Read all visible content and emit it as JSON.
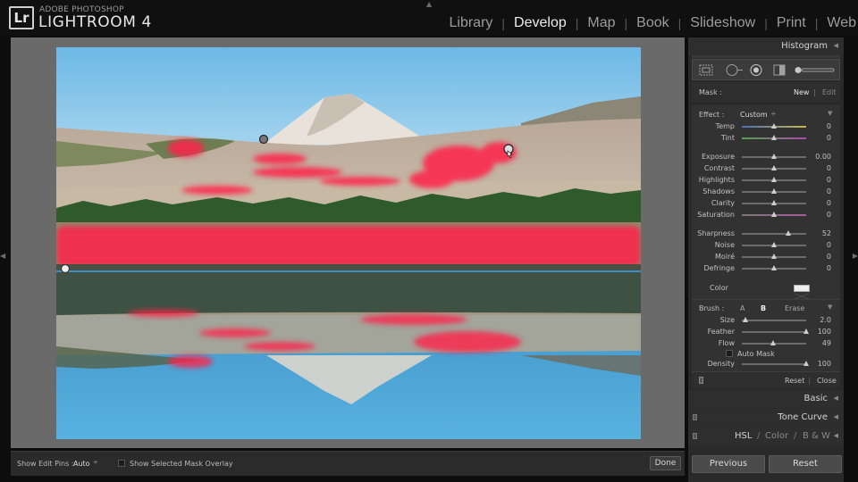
{
  "app": {
    "brand_small": "ADOBE PHOTOSHOP",
    "brand_big": "LIGHTROOM 4",
    "logo_text": "Lr"
  },
  "modules": [
    {
      "label": "Library",
      "active": false
    },
    {
      "label": "Develop",
      "active": true
    },
    {
      "label": "Map",
      "active": false
    },
    {
      "label": "Book",
      "active": false
    },
    {
      "label": "Slideshow",
      "active": false
    },
    {
      "label": "Print",
      "active": false
    },
    {
      "label": "Web",
      "active": false
    }
  ],
  "toolbar": {
    "pins_label": "Show Edit Pins :",
    "pins_value": "Auto",
    "overlay_label": "Show Selected Mask Overlay",
    "done_label": "Done"
  },
  "right_panel": {
    "histogram_title": "Histogram",
    "mask_label": "Mask :",
    "mask_new": "New",
    "mask_edit": "Edit",
    "effect_label": "Effect :",
    "effect_value": "Custom",
    "sliders_group1": [
      {
        "label": "Temp",
        "value": "0",
        "pos": 0.5
      },
      {
        "label": "Tint",
        "value": "0",
        "pos": 0.5
      }
    ],
    "sliders_group2": [
      {
        "label": "Exposure",
        "value": "0.00",
        "pos": 0.5
      },
      {
        "label": "Contrast",
        "value": "0",
        "pos": 0.5
      },
      {
        "label": "Highlights",
        "value": "0",
        "pos": 0.5
      },
      {
        "label": "Shadows",
        "value": "0",
        "pos": 0.5
      },
      {
        "label": "Clarity",
        "value": "0",
        "pos": 0.5
      },
      {
        "label": "Saturation",
        "value": "0",
        "pos": 0.5
      }
    ],
    "sliders_group3": [
      {
        "label": "Sharpness",
        "value": "52",
        "pos": 0.72
      },
      {
        "label": "Noise",
        "value": "0",
        "pos": 0.5
      },
      {
        "label": "Moiré",
        "value": "0",
        "pos": 0.5
      },
      {
        "label": "Defringe",
        "value": "0",
        "pos": 0.5
      }
    ],
    "color_label": "Color",
    "brush_label": "Brush :",
    "brush_a": "A",
    "brush_b": "B",
    "brush_erase": "Erase",
    "brush_sliders": [
      {
        "label": "Size",
        "value": "2.0",
        "pos": 0.05
      },
      {
        "label": "Feather",
        "value": "100",
        "pos": 1.0
      },
      {
        "label": "Flow",
        "value": "49",
        "pos": 0.49
      }
    ],
    "auto_mask_label": "Auto Mask",
    "density": {
      "label": "Density",
      "value": "100",
      "pos": 1.0
    },
    "reset_label": "Reset",
    "close_label": "Close",
    "sections": [
      "Basic",
      "Tone Curve"
    ],
    "hsl_tabs": [
      "HSL",
      "Color",
      "B & W"
    ],
    "previous_button": "Previous",
    "reset_button": "Reset"
  }
}
